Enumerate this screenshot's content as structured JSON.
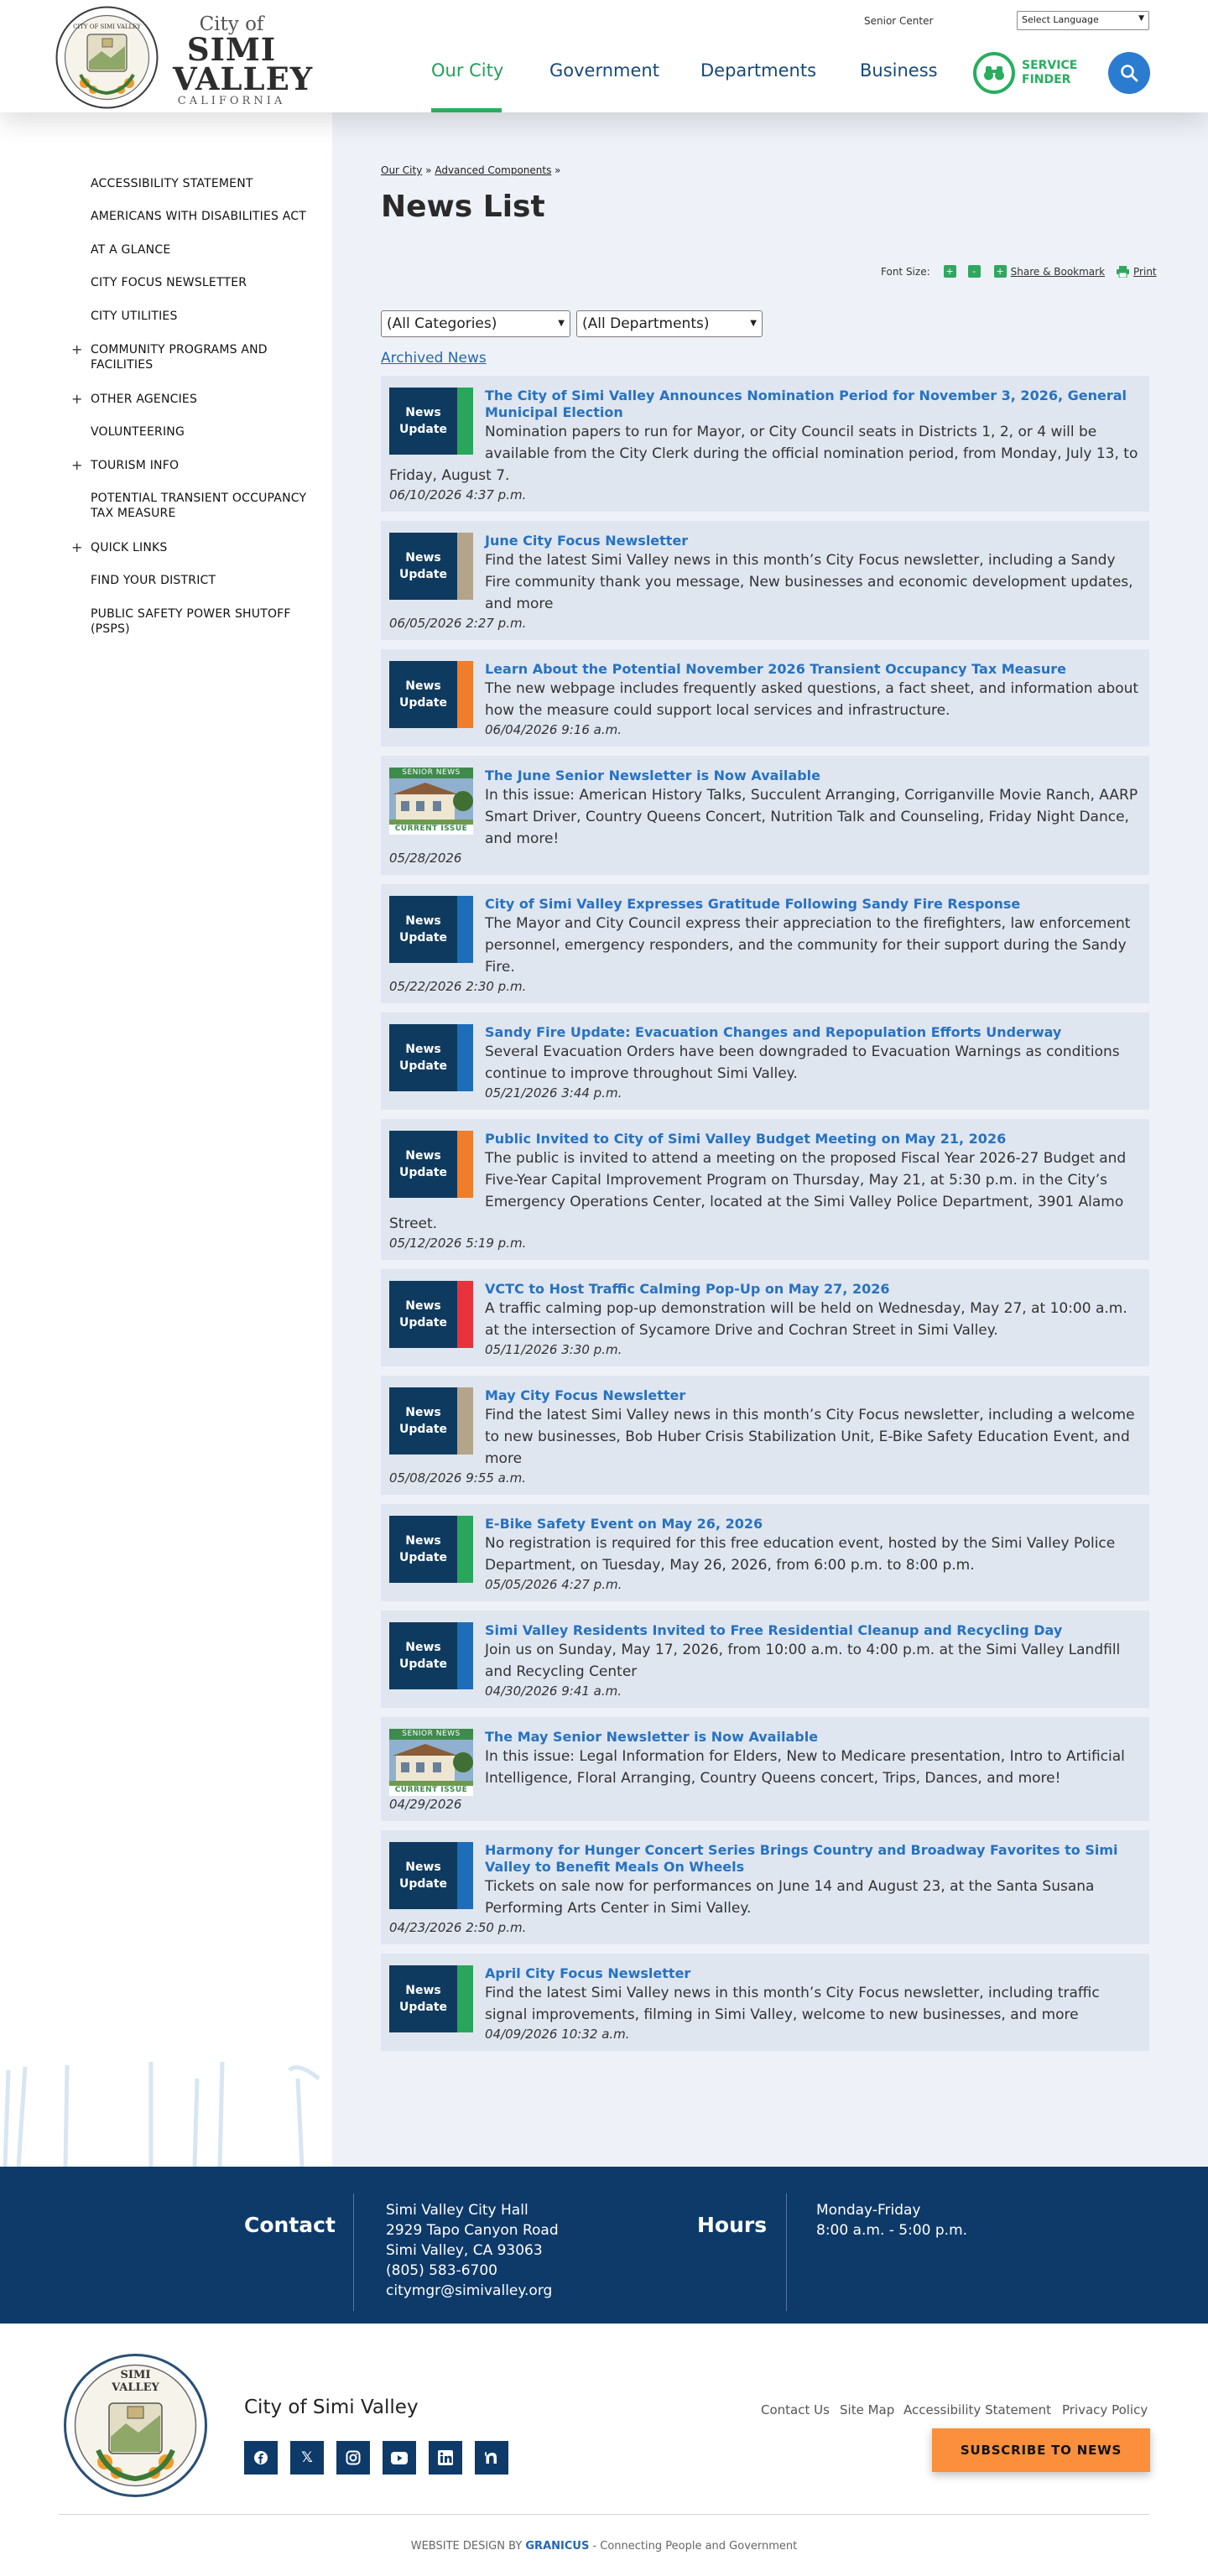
{
  "header": {
    "logo": {
      "city_of": "City of",
      "name_line1": "SIMI",
      "name_line2": "VALLEY",
      "state": "CALIFORNIA",
      "seal_text": "CITY OF SIMI VALLEY"
    },
    "top_link": "Senior Center",
    "language_select": "Select Language",
    "nav": [
      "Our City",
      "Government",
      "Departments",
      "Business"
    ],
    "active_nav": "Our City",
    "service_finder_line1": "SERVICE",
    "service_finder_line2": "FINDER",
    "accent": "#27ae5f",
    "primary": "#17487b",
    "search_icon": "search-icon"
  },
  "sidebar": {
    "items": [
      {
        "label": "Accessibility Statement",
        "expandable": false
      },
      {
        "label": "Americans with Disabilities Act",
        "expandable": false
      },
      {
        "label": "At A Glance",
        "expandable": false
      },
      {
        "label": "City Focus Newsletter",
        "expandable": false
      },
      {
        "label": "City Utilities",
        "expandable": false
      },
      {
        "label": "Community Programs and Facilities",
        "expandable": true
      },
      {
        "label": "Other Agencies",
        "expandable": true
      },
      {
        "label": "Volunteering",
        "expandable": false
      },
      {
        "label": "Tourism Info",
        "expandable": true
      },
      {
        "label": "Potential Transient Occupancy Tax Measure",
        "expandable": false
      },
      {
        "label": "Quick Links",
        "expandable": true
      },
      {
        "label": "Find Your District",
        "expandable": false
      },
      {
        "label": "Public Safety Power Shutoff (PSPS)",
        "expandable": false
      }
    ]
  },
  "main": {
    "breadcrumb": [
      "Our City",
      "Advanced Components"
    ],
    "breadcrumb_sep": "»",
    "title": "News List",
    "font_size_label": "Font Size:",
    "font_plus": "+",
    "font_minus": "-",
    "share_label": "Share & Bookmark",
    "print_label": "Print",
    "category_filter": "(All Categories)",
    "department_filter": "(All Departments)",
    "archived_link": "Archived News",
    "news": [
      {
        "title": "The City of Simi Valley Announces Nomination Period for November 3, 2026, General Municipal Election",
        "summary": "Nomination papers to run for Mayor, or City Council seats in Districts 1, 2, or 4 will be available from the City Clerk during the official nomination period, from Monday, July 13, to Friday, August 7.",
        "date": "06/10/2026 4:37 p.m.",
        "thumb": "news",
        "color": "#2aa55c"
      },
      {
        "title": "June City Focus Newsletter",
        "summary": "Find the latest Simi Valley news in this month’s City Focus newsletter, including a Sandy Fire community thank you message, New businesses and economic development updates, and more",
        "date": "06/05/2026 2:27 p.m.",
        "thumb": "news",
        "color": "#b3a48a"
      },
      {
        "title": "Learn About the Potential November 2026 Transient Occupancy Tax Measure",
        "summary": "The new webpage includes frequently asked questions, a fact sheet, and information about how the measure could support local services and infrastructure.",
        "date": "06/04/2026 9:16 a.m.",
        "thumb": "news",
        "color": "#f07d2a"
      },
      {
        "title": "The June Senior Newsletter is Now Available",
        "summary": "In this issue: American History Talks, Succulent Arranging, Corriganville Movie Ranch, AARP Smart Driver, Country Queens Concert, Nutrition Talk and Counseling, Friday Night Dance, and more!",
        "date": "05/28/2026",
        "thumb": "senior",
        "color": "#6c8a5c",
        "senior_top": "SENIOR NEWS",
        "senior_bottom": "CURRENT ISSUE"
      },
      {
        "title": "City of Simi Valley Expresses Gratitude Following Sandy Fire Response",
        "summary": "The Mayor and City Council express their appreciation to the firefighters, law enforcement personnel, emergency responders, and the community for their support during the Sandy Fire.",
        "date": "05/22/2026 2:30 p.m.",
        "thumb": "news",
        "color": "#1e6db8"
      },
      {
        "title": "Sandy Fire Update: Evacuation Changes and Repopulation Efforts Underway",
        "summary": "Several Evacuation Orders have been downgraded to Evacuation Warnings as conditions continue to improve throughout Simi Valley.",
        "date": "05/21/2026 3:44 p.m.",
        "thumb": "news",
        "color": "#1e6db8"
      },
      {
        "title": "Public Invited to City of Simi Valley Budget Meeting on May 21, 2026",
        "summary": "The public is invited to attend a meeting on the proposed Fiscal Year 2026-27 Budget and Five-Year Capital Improvement Program on Thursday, May 21, at 5:30 p.m. in the City’s Emergency Operations Center, located at the Simi Valley Police Department, 3901 Alamo Street.",
        "date": "05/12/2026 5:19 p.m.",
        "thumb": "news",
        "color": "#f07d2a"
      },
      {
        "title": "VCTC to Host Traffic Calming Pop-Up on May 27, 2026",
        "summary": "A traffic calming pop-up demonstration will be held on Wednesday, May 27, at 10:00 a.m. at the intersection of Sycamore Drive and Cochran Street in Simi Valley.",
        "date": "05/11/2026 3:30 p.m.",
        "thumb": "news",
        "color": "#e8333c"
      },
      {
        "title": "May City Focus Newsletter",
        "summary": "Find the latest Simi Valley news in this month’s City Focus newsletter, including a welcome to new businesses, Bob Huber Crisis Stabilization Unit, E-Bike Safety Education Event, and more",
        "date": "05/08/2026 9:55 a.m.",
        "thumb": "news",
        "color": "#b3a48a"
      },
      {
        "title": "E-Bike Safety Event on May 26, 2026",
        "summary": "No registration is required for this free education event, hosted by the Simi Valley Police Department, on Tuesday, May 26, 2026, from 6:00 p.m. to 8:00 p.m.",
        "date": "05/05/2026 4:27 p.m.",
        "thumb": "news",
        "color": "#2aa55c"
      },
      {
        "title": "Simi Valley Residents Invited to Free Residential Cleanup and Recycling Day",
        "summary": "Join us on Sunday, May 17, 2026, from 10:00 a.m. to 4:00 p.m. at the Simi Valley Landfill and Recycling Center",
        "date": "04/30/2026 9:41 a.m.",
        "thumb": "news",
        "color": "#1e6db8"
      },
      {
        "title": "The May Senior Newsletter is Now Available",
        "summary": "In this issue: Legal Information for Elders, New to Medicare presentation, Intro to Artificial Intelligence, Floral Arranging, Country Queens concert, Trips, Dances, and more!",
        "date": "04/29/2026",
        "thumb": "senior",
        "color": "#6c8a5c",
        "senior_top": "SENIOR NEWS",
        "senior_bottom": "CURRENT ISSUE"
      },
      {
        "title": "Harmony for Hunger Concert Series Brings Country and Broadway Favorites to Simi Valley to Benefit Meals On Wheels",
        "summary": "Tickets on sale now for performances on June 14 and August 23, at the Santa Susana Performing Arts Center in Simi Valley.",
        "date": "04/23/2026 2:50 p.m.",
        "thumb": "news",
        "color": "#1e6db8"
      },
      {
        "title": "April City Focus Newsletter",
        "summary": "Find the latest Simi Valley news in this month’s City Focus newsletter, including traffic signal improvements, filming in Simi Valley, welcome to new businesses, and more",
        "date": "04/09/2026 10:32 a.m.",
        "thumb": "news",
        "color": "#2aa55c"
      }
    ],
    "thumb_label_1": "News",
    "thumb_label_2": "Update"
  },
  "contact": {
    "heading": "Contact",
    "lines": [
      "Simi Valley City Hall",
      "2929 Tapo Canyon Road",
      "Simi Valley, CA 93063",
      "(805) 583-6700",
      "citymgr@simivalley.org"
    ],
    "hours_heading": "Hours",
    "hours_lines": [
      "Monday-Friday",
      "8:00 a.m. - 5:00 p.m."
    ]
  },
  "footer": {
    "name": "City of Simi Valley",
    "links": [
      "Contact Us",
      "Site Map",
      "Accessibility Statement",
      "Privacy Policy"
    ],
    "subscribe": "SUBSCRIBE TO NEWS",
    "social": [
      "facebook-icon",
      "x-icon",
      "instagram-icon",
      "youtube-icon",
      "linkedin-icon",
      "nextdoor-icon"
    ],
    "credit_prefix": "WEBSITE DESIGN BY ",
    "credit_brand": "GRANICUS",
    "credit_suffix": " - Connecting People and Government"
  }
}
